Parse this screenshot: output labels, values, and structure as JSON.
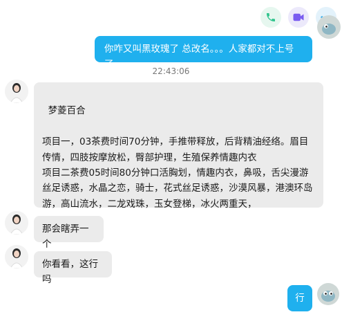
{
  "header": {
    "actions": [
      {
        "name": "voice-call",
        "icon": "phone-icon",
        "color": "#2fc48d"
      },
      {
        "name": "video-call",
        "icon": "video-camera-icon",
        "color": "#7a5cf0"
      },
      {
        "name": "more",
        "icon": "more-dots-icon",
        "color": "#2aa7e8"
      }
    ]
  },
  "messages": [
    {
      "direction": "outgoing",
      "text": "你咋又叫黑玫瑰了 总改名。。。人家都对不上号了"
    },
    {
      "type": "timestamp",
      "text": "22:43:06"
    },
    {
      "direction": "incoming",
      "text": "梦菱百合\n\n项目一，03茶费时间70分钟，手推带释放，后背精油经络。眉目传情，四肢按摩放松，臀部护理，生殖保养情趣内衣\n项目二茶费05时间80分钟口活胸划，情趣内衣，鼻吸，舌尖漫游丝足诱惑，水晶之恋，骑士，花式丝足诱惑，沙漠风暴，港澳环岛游，高山流水，二龙戏珠，玉女登梯，冰火两重天，"
    },
    {
      "direction": "incoming",
      "text": "那会瞎弄一个"
    },
    {
      "direction": "incoming",
      "text": "你看看，这行吗"
    },
    {
      "direction": "outgoing",
      "text": "行"
    }
  ],
  "colors": {
    "outgoing_bubble": "#1fb0ee",
    "incoming_bubble": "#ebebeb"
  }
}
